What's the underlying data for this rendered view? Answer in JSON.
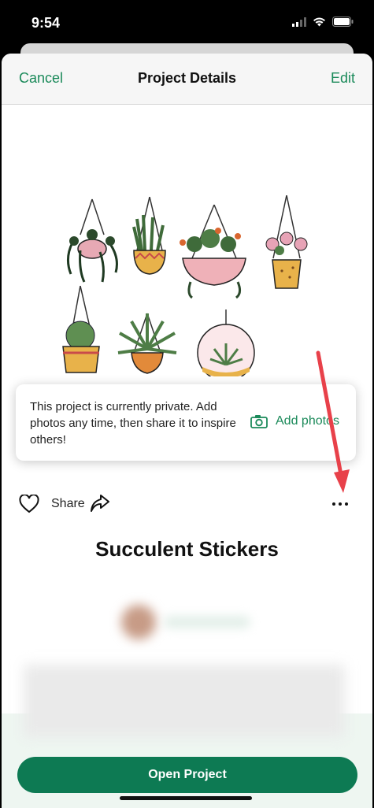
{
  "status": {
    "time": "9:54"
  },
  "nav": {
    "cancel": "Cancel",
    "title": "Project Details",
    "edit": "Edit"
  },
  "tooltip": {
    "message": "This project is currently private. Add photos any time, then share it to inspire others!",
    "action": "Add photos"
  },
  "actions": {
    "share": "Share"
  },
  "project": {
    "title": "Succulent Stickers"
  },
  "cta": {
    "label": "Open Project"
  },
  "colors": {
    "accent": "#1b8a5a",
    "cta": "#0d7a53",
    "annotation_arrow": "#e8414a"
  },
  "icons": [
    "cellular-signal-icon",
    "wifi-icon",
    "battery-icon",
    "heart-icon",
    "share-arrow-icon",
    "more-dots-icon",
    "camera-icon"
  ]
}
